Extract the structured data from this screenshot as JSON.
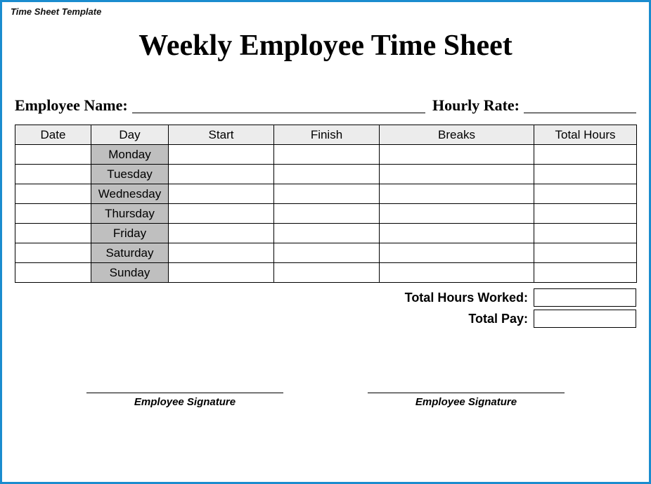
{
  "template_label": "Time Sheet Template",
  "title": "Weekly Employee Time Sheet",
  "fields": {
    "employee_name_label": "Employee Name:",
    "hourly_rate_label": "Hourly Rate:"
  },
  "columns": {
    "date": "Date",
    "day": "Day",
    "start": "Start",
    "finish": "Finish",
    "breaks": "Breaks",
    "total_hours": "Total Hours"
  },
  "days": [
    "Monday",
    "Tuesday",
    "Wednesday",
    "Thursday",
    "Friday",
    "Saturday",
    "Sunday"
  ],
  "rows": [
    {
      "date": "",
      "start": "",
      "finish": "",
      "breaks": "",
      "total": ""
    },
    {
      "date": "",
      "start": "",
      "finish": "",
      "breaks": "",
      "total": ""
    },
    {
      "date": "",
      "start": "",
      "finish": "",
      "breaks": "",
      "total": ""
    },
    {
      "date": "",
      "start": "",
      "finish": "",
      "breaks": "",
      "total": ""
    },
    {
      "date": "",
      "start": "",
      "finish": "",
      "breaks": "",
      "total": ""
    },
    {
      "date": "",
      "start": "",
      "finish": "",
      "breaks": "",
      "total": ""
    },
    {
      "date": "",
      "start": "",
      "finish": "",
      "breaks": "",
      "total": ""
    }
  ],
  "totals": {
    "hours_worked_label": "Total Hours Worked:",
    "pay_label": "Total Pay:",
    "hours_worked_value": "",
    "pay_value": ""
  },
  "signature": {
    "left_label": "Employee Signature",
    "right_label": "Employee Signature"
  }
}
